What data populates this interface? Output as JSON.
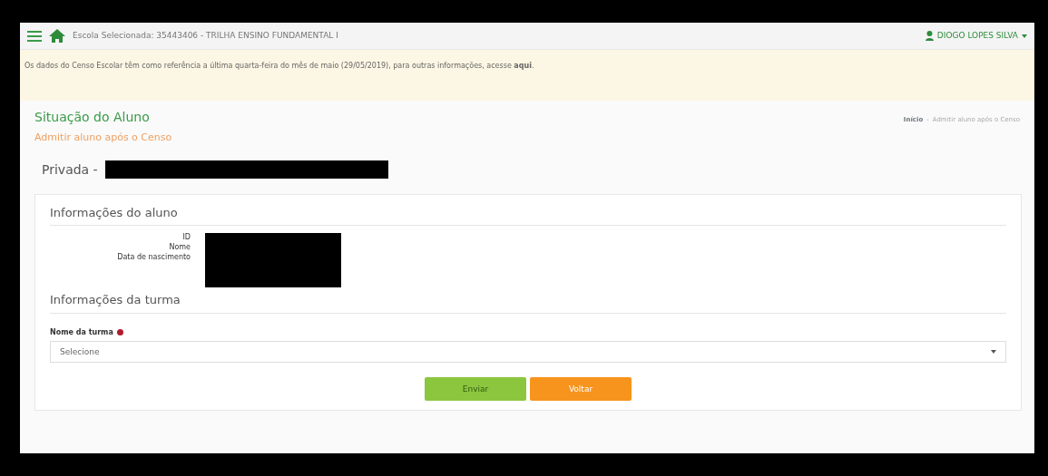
{
  "topbar": {
    "school": "Escola Selecionada: 35443406 - TRILHA ENSINO FUNDAMENTAL I",
    "user": "DIOGO LOPES SILVA"
  },
  "notice": {
    "text": "Os dados do Censo Escolar têm como referência a última quarta-feira do mês de maio (29/05/2019), para outras informações, acesse **aqui**."
  },
  "page": {
    "title": "Situação do Aluno",
    "subtitle": "Admitir aluno após o Censo",
    "breadcrumb_separator": "-",
    "breadcrumb": [
      {
        "label": "Início"
      },
      {
        "label": "Admitir aluno após o Censo"
      }
    ]
  },
  "school_heading": "Privada -",
  "student_section": {
    "title": "Informações do aluno",
    "fields": [
      "ID",
      "Nome",
      "Data de nascimento"
    ]
  },
  "class_section": {
    "title": "Informações da turma",
    "field_label": "Nome da turma",
    "required": true,
    "select_value": "Selecione"
  },
  "buttons": [
    {
      "label": "Enviar",
      "kind": "primary"
    },
    {
      "label": "Voltar",
      "kind": "secondary"
    }
  ]
}
